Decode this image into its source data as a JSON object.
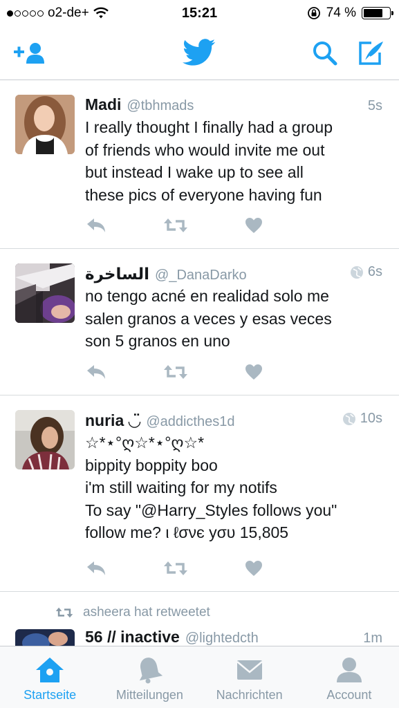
{
  "status_bar": {
    "carrier": "o2-de+",
    "signal_bars": 1,
    "signal_total": 5,
    "time": "15:21",
    "battery_percent_label": "74 %",
    "battery_level": 0.74
  },
  "nav": {
    "add_user_icon": "add-user-icon",
    "logo_icon": "twitter-bird-icon",
    "search_icon": "search-icon",
    "compose_icon": "compose-icon"
  },
  "colors": {
    "brand": "#1da1f2",
    "muted": "#8899a6",
    "text": "#14171a",
    "divider": "#d6dadd"
  },
  "tweets": [
    {
      "name": "Madi",
      "handle": "@tbhmads",
      "time": "5s",
      "globe": false,
      "text": "I really thought I finally had a group\nof friends who would invite me out\nbut instead I wake up to see all\nthese pics of everyone having fun"
    },
    {
      "name": "الساخرة",
      "handle": "@_DanaDarko",
      "time": "6s",
      "globe": true,
      "text": "no tengo acné en realidad solo me\nsalen granos a veces y esas veces\nson 5 granos en uno"
    },
    {
      "name": "nuria ◡̈",
      "handle": "@addicthes1d",
      "time": "10s",
      "globe": true,
      "text": "☆*⋆°ღ☆*⋆°ღ☆*\nbippity boppity boo\ni'm still waiting for my notifs\nTo say \"@Harry_Styles follows you\"\nfollow me?  ι ℓσνє уσυ 15,805"
    },
    {
      "retweet_context": "asheera hat retweetet",
      "name": "56 // inactive",
      "handle": "@lightedcth",
      "time": "1m",
      "globe": false,
      "text": ""
    }
  ],
  "tabs": [
    {
      "label": "Startseite",
      "icon": "home-icon",
      "active": true
    },
    {
      "label": "Mitteilungen",
      "icon": "bell-icon",
      "active": false
    },
    {
      "label": "Nachrichten",
      "icon": "envelope-icon",
      "active": false
    },
    {
      "label": "Account",
      "icon": "person-icon",
      "active": false
    }
  ]
}
